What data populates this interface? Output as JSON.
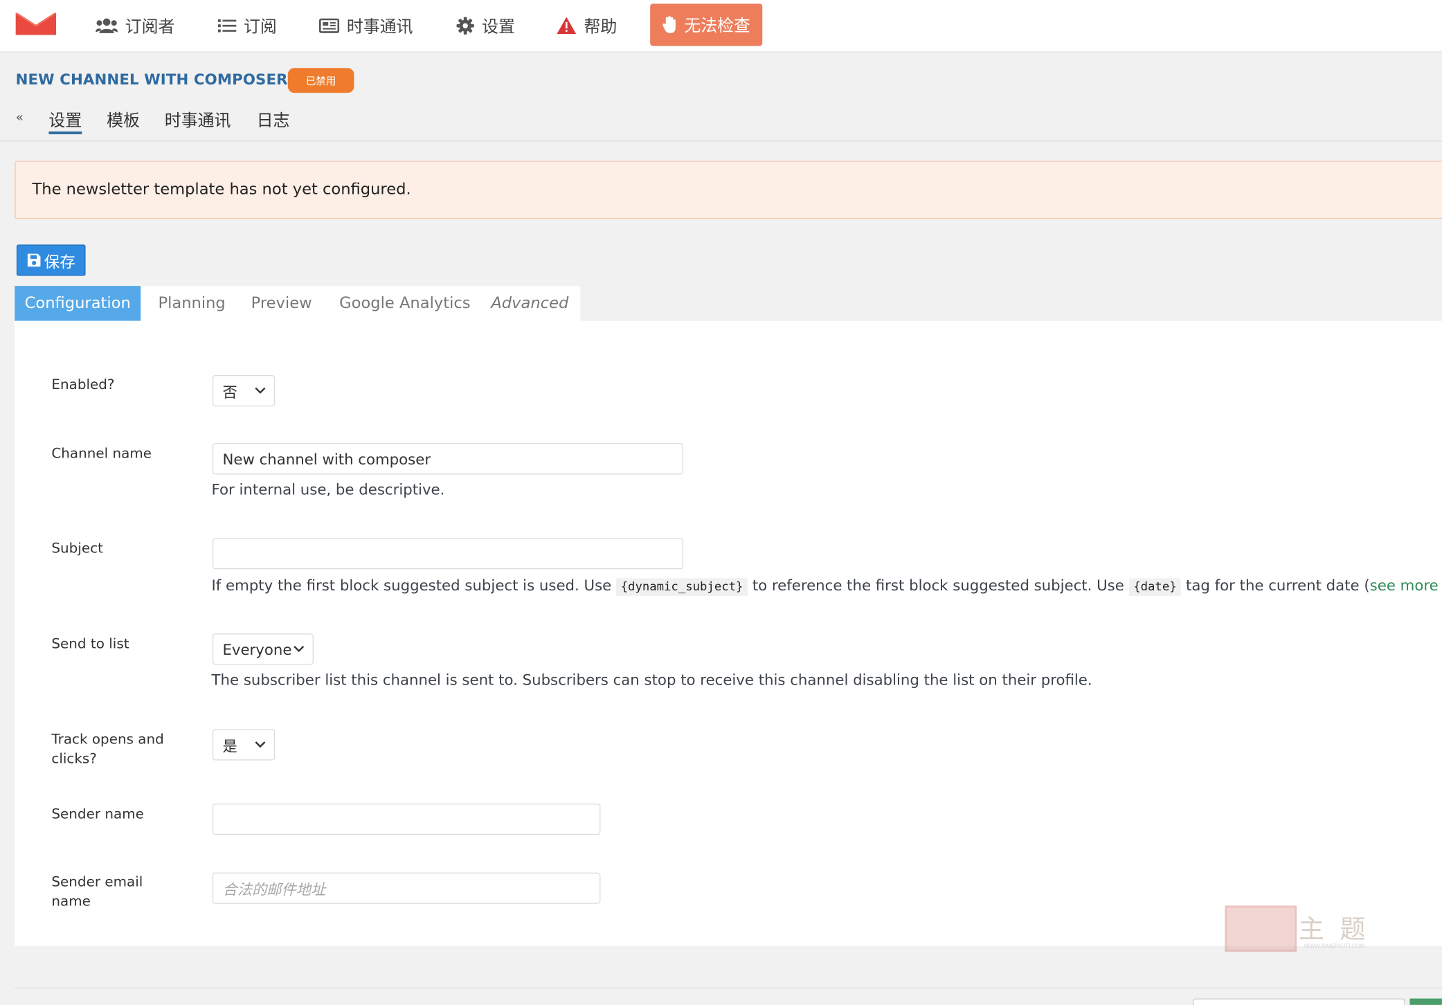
{
  "nav": {
    "subscribers": "订阅者",
    "lists": "订阅",
    "newsletters": "时事通讯",
    "settings": "设置",
    "help": "帮助",
    "check": "无法检查"
  },
  "channel": {
    "title": "NEW CHANNEL WITH COMPOSER",
    "status_badge": "已禁用"
  },
  "subnav": {
    "back": "«",
    "items": [
      "设置",
      "模板",
      "时事通讯",
      "日志"
    ],
    "active_index": 0
  },
  "notice": {
    "text": "The newsletter template has not yet configured."
  },
  "save_label": "保存",
  "tabs": {
    "items": [
      "Configuration",
      "Planning",
      "Preview",
      "Google Analytics",
      "Advanced"
    ],
    "active_index": 0
  },
  "form": {
    "enabled": {
      "label": "Enabled?",
      "value": "否"
    },
    "channel_name": {
      "label": "Channel name",
      "value": "New channel with composer",
      "help": "For internal use, be descriptive."
    },
    "subject": {
      "label": "Subject",
      "value": "",
      "help_part1": "If empty the first block suggested subject is used. Use",
      "help_code1": "{dynamic_subject}",
      "help_part2": "to reference the first block suggested subject. Use",
      "help_code2": "{date}",
      "help_part3": "tag for the current date (",
      "help_link": "see more optio"
    },
    "send_to_list": {
      "label": "Send to list",
      "value": "Everyone",
      "help": "The subscriber list this channel is sent to. Subscribers can stop to receive this channel disabling the list on their profile."
    },
    "track": {
      "label_line1": "Track opens and",
      "label_line2": "clicks?",
      "value": "是"
    },
    "sender_name": {
      "label": "Sender name",
      "value": ""
    },
    "sender_email": {
      "label_line1": "Sender email",
      "label_line2": "name",
      "placeholder": "合法的邮件地址"
    }
  },
  "watermark": {
    "text": "主 题",
    "small": "WWW.BANZHUTI.COM"
  },
  "colors": {
    "accent_blue": "#2f6aa0",
    "save_blue": "#2f8be0",
    "tab_active": "#56a9e8",
    "check_button": "#ee7d5b",
    "badge_orange": "#ee7c2c",
    "notice_bg": "#fdefe6",
    "logo_red": "#e9493f"
  }
}
